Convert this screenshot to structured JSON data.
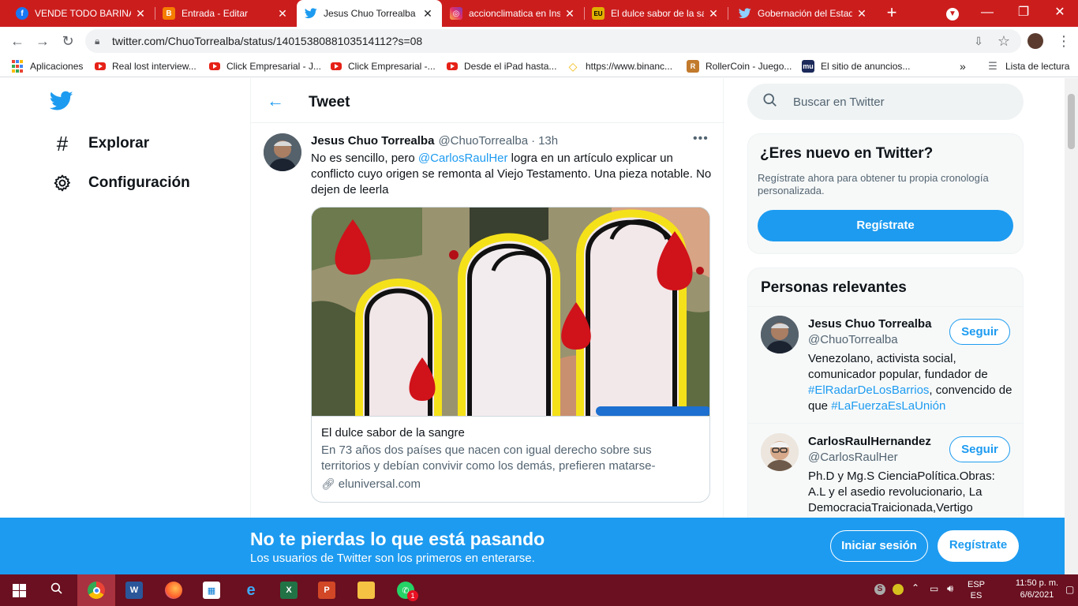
{
  "browser": {
    "tabs": [
      {
        "title": "VENDE TODO BARINA",
        "favicon": "facebook-icon",
        "color": "#1877f2",
        "glyph": "f"
      },
      {
        "title": "Entrada - Editar",
        "favicon": "blogger-icon",
        "color": "#f57d00",
        "glyph": "B"
      },
      {
        "title": "Jesus Chuo Torrealba",
        "favicon": "twitter-icon",
        "color": "#1d9bf0",
        "glyph": ""
      },
      {
        "title": "accionclimatica en Inst",
        "favicon": "instagram-icon",
        "color": "#d6249f",
        "glyph": ""
      },
      {
        "title": "El dulce sabor de la sa",
        "favicon": "eluniversal-icon",
        "color": "#e0b000",
        "glyph": "EU"
      },
      {
        "title": "Gobernación del Estad",
        "favicon": "twitter-icon",
        "color": "#1d9bf0",
        "glyph": ""
      }
    ],
    "url": "twitter.com/ChuoTorrealba/status/1401538088103514112?s=08",
    "bookmarks": [
      {
        "label": "Aplicaciones",
        "icon": "apps-grid-icon"
      },
      {
        "label": "Real lost interview...",
        "icon": "youtube-icon"
      },
      {
        "label": "Click Empresarial - J...",
        "icon": "youtube-icon"
      },
      {
        "label": "Click Empresarial -...",
        "icon": "youtube-icon"
      },
      {
        "label": "Desde el iPad hasta...",
        "icon": "youtube-icon"
      },
      {
        "label": "https://www.binanc...",
        "icon": "binance-icon"
      },
      {
        "label": "RollerCoin - Juego...",
        "icon": "rollercoin-icon"
      },
      {
        "label": "El sitio de anuncios...",
        "icon": "mu-icon"
      }
    ],
    "overflow_label": "»",
    "reading_list": "Lista de lectura"
  },
  "twitter": {
    "nav": [
      {
        "label": "Explorar",
        "icon": "hashtag-icon"
      },
      {
        "label": "Configuración",
        "icon": "gear-icon"
      }
    ],
    "header_title": "Tweet",
    "tweet": {
      "name": "Jesus Chuo Torrealba",
      "handle": "@ChuoTorrealba",
      "sep": "·",
      "time": "13h",
      "text_before": "No es sencillo, pero ",
      "mention": "@CarlosRaulHer",
      "text_after": " logra en un artículo explicar un conflicto cuyo origen se remonta al Viejo Testamento. Una pieza notable. No dejen de leerla",
      "card": {
        "title": "El dulce sabor de la sangre",
        "description": "En 73 años dos países que nacen con igual derecho sobre sus territorios y debían convivir como los demás, prefieren matarse-vengarse-matars…",
        "domain": "eluniversal.com"
      }
    },
    "search_placeholder": "Buscar en Twitter",
    "new_box": {
      "title": "¿Eres nuevo en Twitter?",
      "text": "Regístrate ahora para obtener tu propia cronología personalizada.",
      "button": "Regístrate"
    },
    "relevant": {
      "title": "Personas relevantes",
      "people": [
        {
          "name": "Jesus Chuo Torrealba",
          "handle": "@ChuoTorrealba",
          "button": "Seguir",
          "bio_parts": [
            {
              "t": "Venezolano, activista social, comunicador popular, fundador de ",
              "link": false
            },
            {
              "t": "#ElRadarDeLosBarrios",
              "link": true
            },
            {
              "t": ", convencido de que ",
              "link": false
            },
            {
              "t": "#LaFuerzaEsLaUnión",
              "link": true
            }
          ]
        },
        {
          "name": "CarlosRaulHernandez",
          "handle": "@CarlosRaulHer",
          "button": "Seguir",
          "bio_parts": [
            {
              "t": "Ph.D y Mg.S CienciaPolítica.Obras: A.L y el asedio revolucionario, La DemocraciaTraicionada,Vertigo",
              "link": false
            }
          ]
        }
      ]
    },
    "banner": {
      "title": "No te pierdas lo que está pasando",
      "subtitle": "Los usuarios de Twitter son los primeros en enterarse.",
      "login": "Iniciar sesión",
      "signup": "Regístrate"
    }
  },
  "taskbar": {
    "apps": [
      "start-icon",
      "search-icon",
      "chrome-icon",
      "word-icon",
      "firefox-icon",
      "store-icon",
      "edge-icon",
      "excel-icon",
      "powerpoint-icon",
      "explorer-icon",
      "whatsapp-icon"
    ],
    "whatsapp_badge": "1",
    "lang_top": "ESP",
    "lang_bottom": "ES",
    "time": "11:50 p. m.",
    "date": "6/6/2021"
  }
}
